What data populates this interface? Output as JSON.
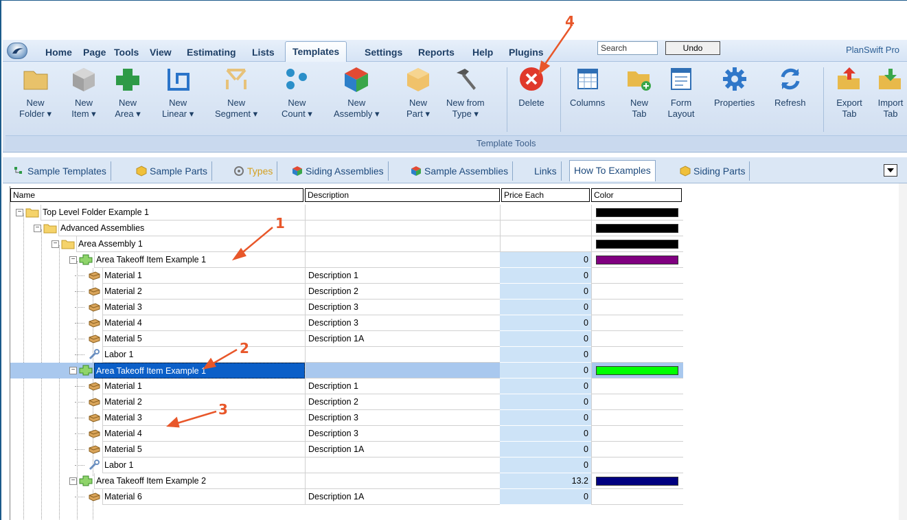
{
  "menu": {
    "items": [
      "Home",
      "Page",
      "Tools",
      "View",
      "Estimating",
      "Lists",
      "Templates",
      "Settings",
      "Reports",
      "Help",
      "Plugins"
    ],
    "search_placeholder": "Search",
    "undo_label": "Undo",
    "app_title": "PlanSwift Pro"
  },
  "ribbon": {
    "buttons": [
      {
        "label1": "New",
        "label2": "Folder ▾"
      },
      {
        "label1": "New",
        "label2": "Item ▾"
      },
      {
        "label1": "New",
        "label2": "Area ▾"
      },
      {
        "label1": "New",
        "label2": "Linear ▾"
      },
      {
        "label1": "New",
        "label2": "Segment ▾"
      },
      {
        "label1": "New",
        "label2": "Count ▾"
      },
      {
        "label1": "New",
        "label2": "Assembly ▾"
      },
      {
        "label1": "New",
        "label2": "Part ▾"
      },
      {
        "label1": "New from",
        "label2": "Type ▾"
      },
      {
        "label1": "Delete",
        "label2": ""
      },
      {
        "label1": "Columns",
        "label2": ""
      },
      {
        "label1": "New",
        "label2": "Tab"
      },
      {
        "label1": "Form",
        "label2": "Layout"
      },
      {
        "label1": "Properties",
        "label2": ""
      },
      {
        "label1": "Refresh",
        "label2": ""
      },
      {
        "label1": "Export",
        "label2": "Tab"
      },
      {
        "label1": "Import",
        "label2": "Tab"
      }
    ],
    "group_label": "Template Tools"
  },
  "tabs": [
    "Sample Templates",
    "Sample Parts",
    "Types",
    "Siding Assemblies",
    "Sample Assemblies",
    "Links",
    "How To Examples",
    "Siding Parts"
  ],
  "grid": {
    "columns": [
      "Name",
      "Description",
      "Price Each",
      "Color"
    ],
    "rows": [
      {
        "name": "Top Level Folder Example 1",
        "desc": "",
        "price": "",
        "color": "#000000"
      },
      {
        "name": "Advanced Assemblies",
        "desc": "",
        "price": "",
        "color": "#000000"
      },
      {
        "name": "Area Assembly 1",
        "desc": "",
        "price": "",
        "color": "#000000"
      },
      {
        "name": "Area Takeoff Item Example 1",
        "desc": "",
        "price": "0",
        "color": "#800080"
      },
      {
        "name": "Material 1",
        "desc": "Description 1",
        "price": "0",
        "color": ""
      },
      {
        "name": "Material 2",
        "desc": "Description 2",
        "price": "0",
        "color": ""
      },
      {
        "name": "Material 3",
        "desc": "Description 3",
        "price": "0",
        "color": ""
      },
      {
        "name": "Material 4",
        "desc": "Description 3",
        "price": "0",
        "color": ""
      },
      {
        "name": "Material 5",
        "desc": "Description 1A",
        "price": "0",
        "color": ""
      },
      {
        "name": "Labor 1",
        "desc": "",
        "price": "0",
        "color": ""
      },
      {
        "name": "Area Takeoff Item Example 1",
        "desc": "",
        "price": "0",
        "color": "#00ff00"
      },
      {
        "name": "Material 1",
        "desc": "Description 1",
        "price": "0",
        "color": ""
      },
      {
        "name": "Material 2",
        "desc": "Description 2",
        "price": "0",
        "color": ""
      },
      {
        "name": "Material 3",
        "desc": "Description 3",
        "price": "0",
        "color": ""
      },
      {
        "name": "Material 4",
        "desc": "Description 3",
        "price": "0",
        "color": ""
      },
      {
        "name": "Material 5",
        "desc": "Description 1A",
        "price": "0",
        "color": ""
      },
      {
        "name": "Labor 1",
        "desc": "",
        "price": "0",
        "color": ""
      },
      {
        "name": "Area Takeoff Item Example 2",
        "desc": "",
        "price": "13.2",
        "color": "#000080"
      },
      {
        "name": "Material 6",
        "desc": "Description 1A",
        "price": "0",
        "color": ""
      }
    ]
  },
  "annotations": [
    "1",
    "2",
    "3",
    "4"
  ]
}
